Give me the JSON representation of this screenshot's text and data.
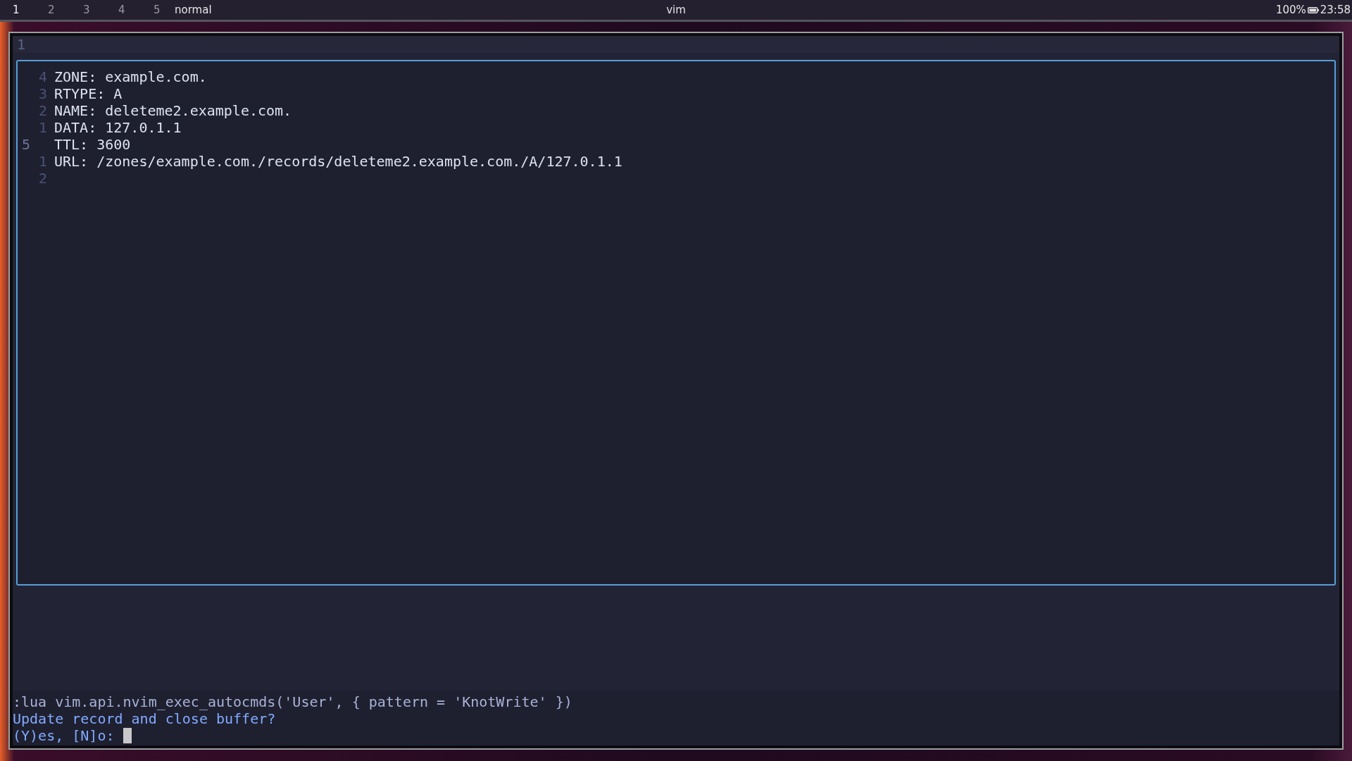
{
  "topbar": {
    "workspaces": [
      {
        "label": "1",
        "selected": true
      },
      {
        "label": "2",
        "selected": false
      },
      {
        "label": "3",
        "selected": false
      },
      {
        "label": "4",
        "selected": false
      },
      {
        "label": "5",
        "selected": false
      }
    ],
    "mode": "normal",
    "title": "vim",
    "battery": "100%",
    "clock": "23:58"
  },
  "editor": {
    "line_number": "1"
  },
  "float": {
    "lines": [
      {
        "number": "4",
        "text": "ZONE: example.com.",
        "current": false
      },
      {
        "number": "3",
        "text": "RTYPE: A",
        "current": false
      },
      {
        "number": "2",
        "text": "NAME: deleteme2.example.com.",
        "current": false
      },
      {
        "number": "1",
        "text": "DATA: 127.0.1.1",
        "current": false
      },
      {
        "number": "5",
        "text": "TTL: 3600",
        "current": true
      },
      {
        "number": "1",
        "text": "URL: /zones/example.com./records/deleteme2.example.com./A/127.0.1.1",
        "current": false
      },
      {
        "number": "2",
        "current": false
      }
    ]
  },
  "cmdline": {
    "command": ":lua vim.api.nvim_exec_autocmds('User', { pattern = 'KnotWrite' })",
    "prompt": "Update record and close buffer?",
    "input_prompt": "(Y)es, [N]o:"
  }
}
